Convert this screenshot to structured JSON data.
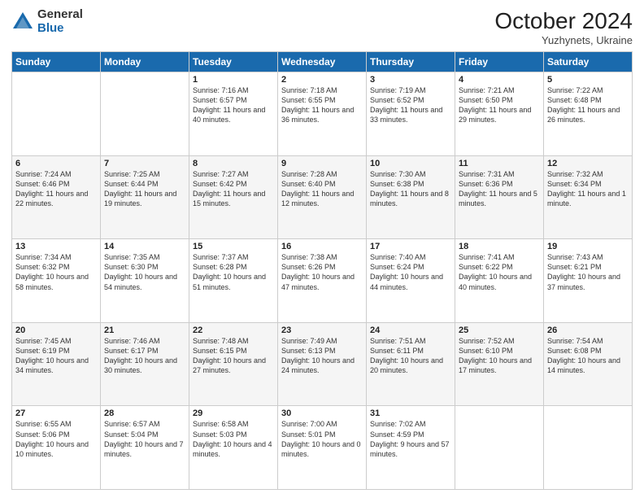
{
  "header": {
    "logo": {
      "general": "General",
      "blue": "Blue"
    },
    "title": "October 2024",
    "subtitle": "Yuzhynets, Ukraine"
  },
  "days_of_week": [
    "Sunday",
    "Monday",
    "Tuesday",
    "Wednesday",
    "Thursday",
    "Friday",
    "Saturday"
  ],
  "weeks": [
    [
      {
        "day": "",
        "info": ""
      },
      {
        "day": "",
        "info": ""
      },
      {
        "day": "1",
        "info": "Sunrise: 7:16 AM\nSunset: 6:57 PM\nDaylight: 11 hours and 40 minutes."
      },
      {
        "day": "2",
        "info": "Sunrise: 7:18 AM\nSunset: 6:55 PM\nDaylight: 11 hours and 36 minutes."
      },
      {
        "day": "3",
        "info": "Sunrise: 7:19 AM\nSunset: 6:52 PM\nDaylight: 11 hours and 33 minutes."
      },
      {
        "day": "4",
        "info": "Sunrise: 7:21 AM\nSunset: 6:50 PM\nDaylight: 11 hours and 29 minutes."
      },
      {
        "day": "5",
        "info": "Sunrise: 7:22 AM\nSunset: 6:48 PM\nDaylight: 11 hours and 26 minutes."
      }
    ],
    [
      {
        "day": "6",
        "info": "Sunrise: 7:24 AM\nSunset: 6:46 PM\nDaylight: 11 hours and 22 minutes."
      },
      {
        "day": "7",
        "info": "Sunrise: 7:25 AM\nSunset: 6:44 PM\nDaylight: 11 hours and 19 minutes."
      },
      {
        "day": "8",
        "info": "Sunrise: 7:27 AM\nSunset: 6:42 PM\nDaylight: 11 hours and 15 minutes."
      },
      {
        "day": "9",
        "info": "Sunrise: 7:28 AM\nSunset: 6:40 PM\nDaylight: 11 hours and 12 minutes."
      },
      {
        "day": "10",
        "info": "Sunrise: 7:30 AM\nSunset: 6:38 PM\nDaylight: 11 hours and 8 minutes."
      },
      {
        "day": "11",
        "info": "Sunrise: 7:31 AM\nSunset: 6:36 PM\nDaylight: 11 hours and 5 minutes."
      },
      {
        "day": "12",
        "info": "Sunrise: 7:32 AM\nSunset: 6:34 PM\nDaylight: 11 hours and 1 minute."
      }
    ],
    [
      {
        "day": "13",
        "info": "Sunrise: 7:34 AM\nSunset: 6:32 PM\nDaylight: 10 hours and 58 minutes."
      },
      {
        "day": "14",
        "info": "Sunrise: 7:35 AM\nSunset: 6:30 PM\nDaylight: 10 hours and 54 minutes."
      },
      {
        "day": "15",
        "info": "Sunrise: 7:37 AM\nSunset: 6:28 PM\nDaylight: 10 hours and 51 minutes."
      },
      {
        "day": "16",
        "info": "Sunrise: 7:38 AM\nSunset: 6:26 PM\nDaylight: 10 hours and 47 minutes."
      },
      {
        "day": "17",
        "info": "Sunrise: 7:40 AM\nSunset: 6:24 PM\nDaylight: 10 hours and 44 minutes."
      },
      {
        "day": "18",
        "info": "Sunrise: 7:41 AM\nSunset: 6:22 PM\nDaylight: 10 hours and 40 minutes."
      },
      {
        "day": "19",
        "info": "Sunrise: 7:43 AM\nSunset: 6:21 PM\nDaylight: 10 hours and 37 minutes."
      }
    ],
    [
      {
        "day": "20",
        "info": "Sunrise: 7:45 AM\nSunset: 6:19 PM\nDaylight: 10 hours and 34 minutes."
      },
      {
        "day": "21",
        "info": "Sunrise: 7:46 AM\nSunset: 6:17 PM\nDaylight: 10 hours and 30 minutes."
      },
      {
        "day": "22",
        "info": "Sunrise: 7:48 AM\nSunset: 6:15 PM\nDaylight: 10 hours and 27 minutes."
      },
      {
        "day": "23",
        "info": "Sunrise: 7:49 AM\nSunset: 6:13 PM\nDaylight: 10 hours and 24 minutes."
      },
      {
        "day": "24",
        "info": "Sunrise: 7:51 AM\nSunset: 6:11 PM\nDaylight: 10 hours and 20 minutes."
      },
      {
        "day": "25",
        "info": "Sunrise: 7:52 AM\nSunset: 6:10 PM\nDaylight: 10 hours and 17 minutes."
      },
      {
        "day": "26",
        "info": "Sunrise: 7:54 AM\nSunset: 6:08 PM\nDaylight: 10 hours and 14 minutes."
      }
    ],
    [
      {
        "day": "27",
        "info": "Sunrise: 6:55 AM\nSunset: 5:06 PM\nDaylight: 10 hours and 10 minutes."
      },
      {
        "day": "28",
        "info": "Sunrise: 6:57 AM\nSunset: 5:04 PM\nDaylight: 10 hours and 7 minutes."
      },
      {
        "day": "29",
        "info": "Sunrise: 6:58 AM\nSunset: 5:03 PM\nDaylight: 10 hours and 4 minutes."
      },
      {
        "day": "30",
        "info": "Sunrise: 7:00 AM\nSunset: 5:01 PM\nDaylight: 10 hours and 0 minutes."
      },
      {
        "day": "31",
        "info": "Sunrise: 7:02 AM\nSunset: 4:59 PM\nDaylight: 9 hours and 57 minutes."
      },
      {
        "day": "",
        "info": ""
      },
      {
        "day": "",
        "info": ""
      }
    ]
  ]
}
